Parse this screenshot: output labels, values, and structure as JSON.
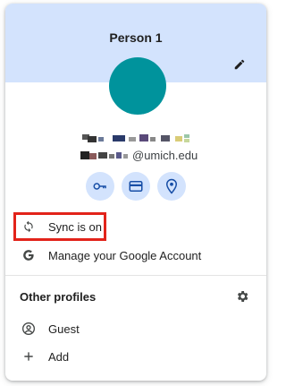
{
  "profile": {
    "name": "Person 1",
    "email_domain": "@umich.edu",
    "avatar_color": "#00939c",
    "header_color": "#d3e3fd"
  },
  "icons": {
    "edit": "pencil-icon",
    "passwords": "key-icon",
    "payments": "credit-card-icon",
    "addresses": "location-pin-icon",
    "sync": "sync-icon",
    "google": "google-g-icon",
    "settings": "gear-icon",
    "guest": "person-circle-icon",
    "add": "plus-icon"
  },
  "menu": {
    "sync_label": "Sync is on",
    "manage_label": "Manage your Google Account"
  },
  "other_profiles": {
    "title": "Other profiles",
    "guest_label": "Guest",
    "add_label": "Add"
  },
  "highlight_color": "#e2231a"
}
